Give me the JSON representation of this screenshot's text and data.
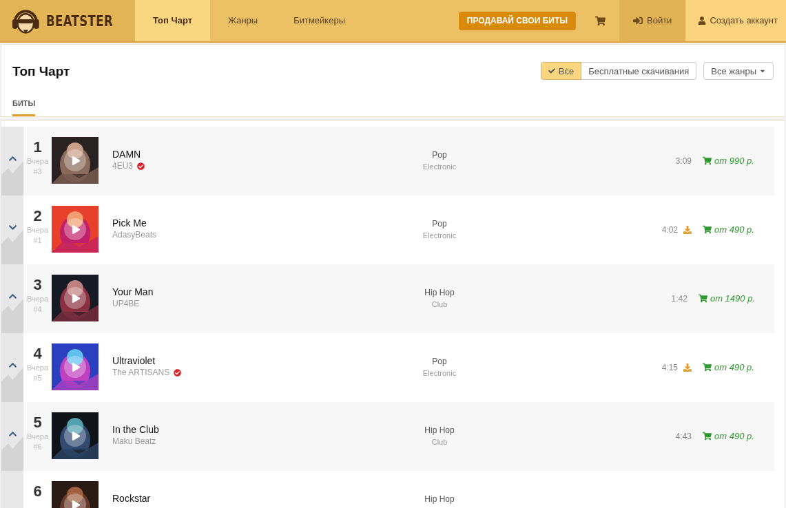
{
  "header": {
    "logo": "BEATSTER",
    "nav": [
      {
        "label": "Топ Чарт",
        "selected": true
      },
      {
        "label": "Жанры",
        "selected": false
      },
      {
        "label": "Битмейкеры",
        "selected": false
      }
    ],
    "sell_button": "ПРОДАВАЙ СВОИ БИТЫ",
    "login": "Войти",
    "signup": "Создать аккаунт"
  },
  "page": {
    "title": "Топ Чарт",
    "filters": [
      {
        "label": "Все",
        "selected": true
      },
      {
        "label": "Бесплатные скачивания",
        "selected": false
      }
    ],
    "genre_dropdown": "Все жанры",
    "tabs": [
      {
        "label": "БИТЫ",
        "selected": true
      }
    ]
  },
  "rows": [
    {
      "rank": "1",
      "trend_up": true,
      "yesterday": "Вчера",
      "yesterday_rank": "#3",
      "title": "DAMN",
      "author": "4EU3",
      "verified": true,
      "genre": "Pop",
      "subgenre": "Electronic",
      "duration": "3:09",
      "free_download": false,
      "price": "от 990 р."
    },
    {
      "rank": "2",
      "trend_up": false,
      "yesterday": "Вчера",
      "yesterday_rank": "#1",
      "title": "Pick Me",
      "author": "AdasyBeats",
      "verified": false,
      "genre": "Pop",
      "subgenre": "Electronic",
      "duration": "4:02",
      "free_download": true,
      "price": "от 490 р."
    },
    {
      "rank": "3",
      "trend_up": true,
      "yesterday": "Вчера",
      "yesterday_rank": "#4",
      "title": "Your Man",
      "author": "UP4BE",
      "verified": false,
      "genre": "Hip Hop",
      "subgenre": "Club",
      "duration": "1:42",
      "free_download": false,
      "price": "от 1490 р."
    },
    {
      "rank": "4",
      "trend_up": true,
      "yesterday": "Вчера",
      "yesterday_rank": "#5",
      "title": "Ultraviolet",
      "author": "The ARTISANS",
      "verified": true,
      "genre": "Pop",
      "subgenre": "Electronic",
      "duration": "4:15",
      "free_download": true,
      "price": "от 490 р."
    },
    {
      "rank": "5",
      "trend_up": true,
      "yesterday": "Вчера",
      "yesterday_rank": "#6",
      "title": "In the Club",
      "author": "Maku Beatz",
      "verified": false,
      "genre": "Hip Hop",
      "subgenre": "Club",
      "duration": "4:43",
      "free_download": false,
      "price": "от 490 р."
    },
    {
      "rank": "6",
      "title": "Rockstar",
      "genre": "Hip Hop"
    }
  ]
}
